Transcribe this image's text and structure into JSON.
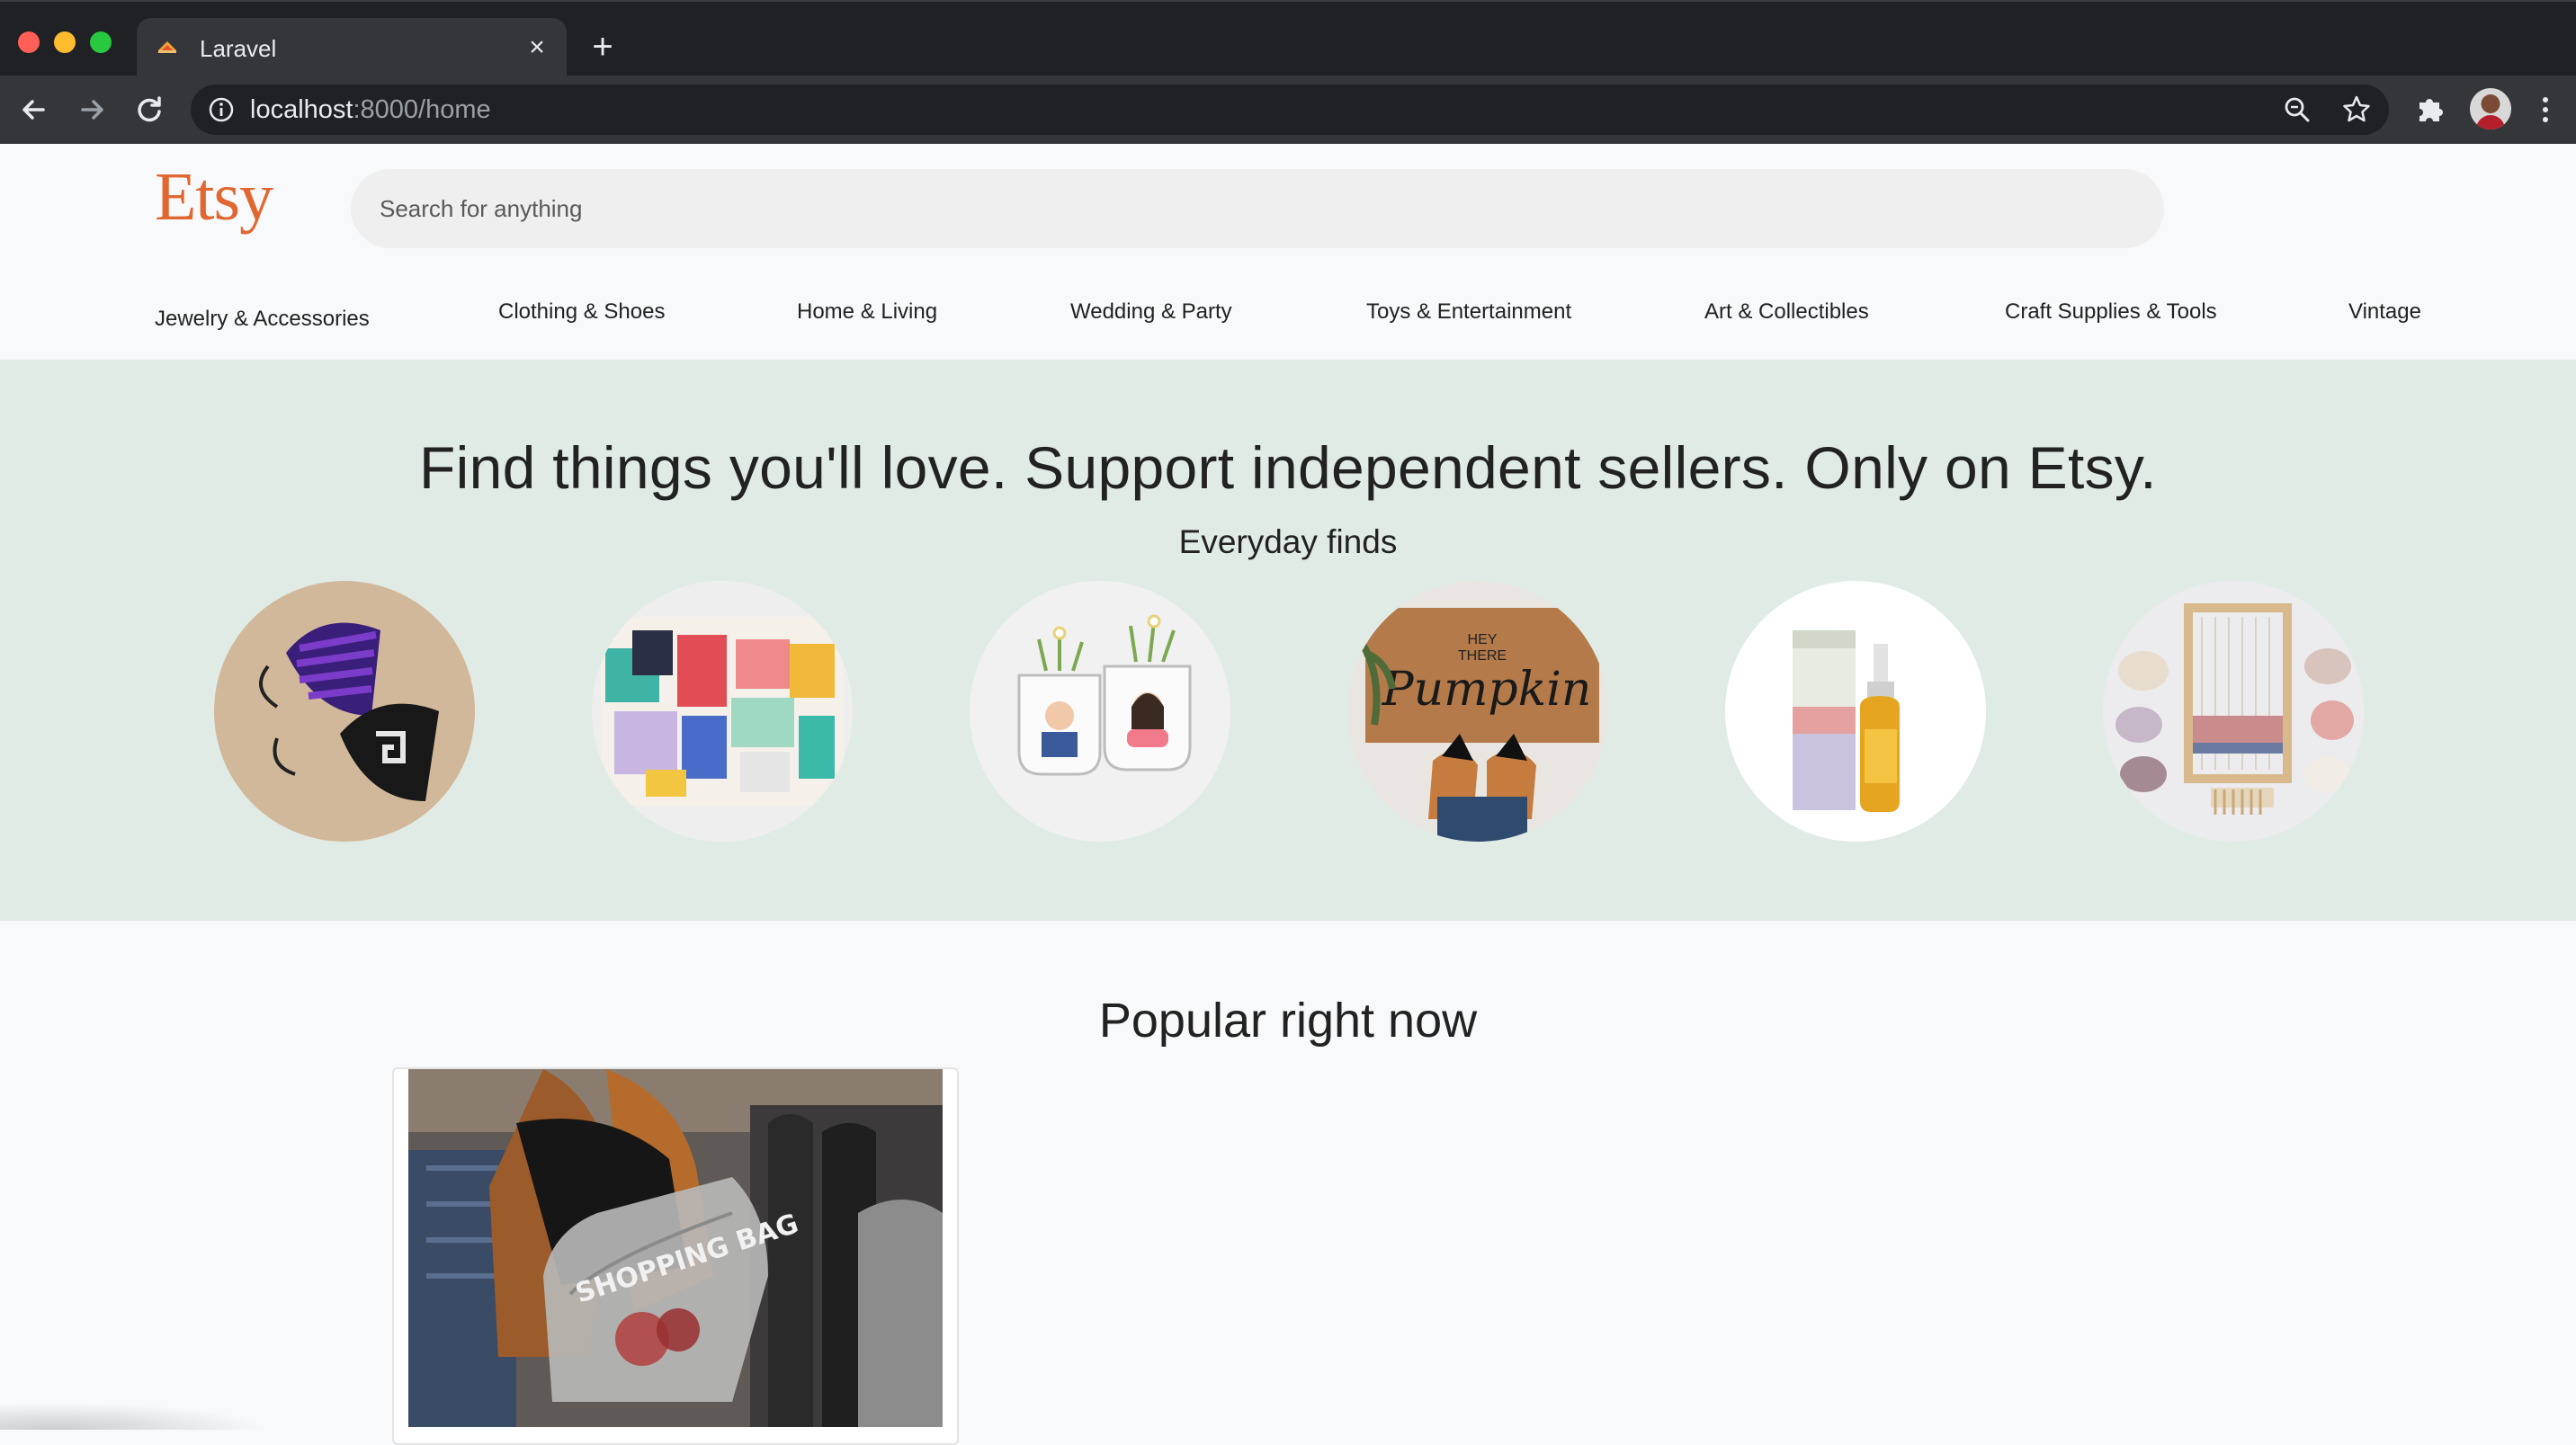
{
  "browser": {
    "tab_title": "Laravel",
    "tab_close": "×",
    "new_tab": "+",
    "url_host": "localhost",
    "url_path": ":8000/home"
  },
  "header": {
    "logo": "Etsy",
    "search_placeholder": "Search for anything"
  },
  "categories": [
    "Jewelry & Accessories",
    "Clothing & Shoes",
    "Home & Living",
    "Wedding & Party",
    "Toys & Entertainment",
    "Art & Collectibles",
    "Craft Supplies & Tools",
    "Vintage"
  ],
  "hero": {
    "title": "Find things you'll love. Support independent sellers. Only on Etsy.",
    "subtitle": "Everyday finds"
  },
  "popular": {
    "title": "Popular right now"
  },
  "colors": {
    "brand": "#e16730",
    "hero_bg": "#e1ebe6",
    "chrome_dark": "#202124",
    "chrome_mid": "#35363a"
  },
  "icons": {
    "back": "arrow-left-icon",
    "forward": "arrow-right-icon",
    "reload": "reload-icon",
    "info": "info-icon",
    "zoom": "zoom-icon",
    "bookmark": "star-icon",
    "extensions": "puzzle-icon",
    "menu": "kebab-menu-icon"
  }
}
